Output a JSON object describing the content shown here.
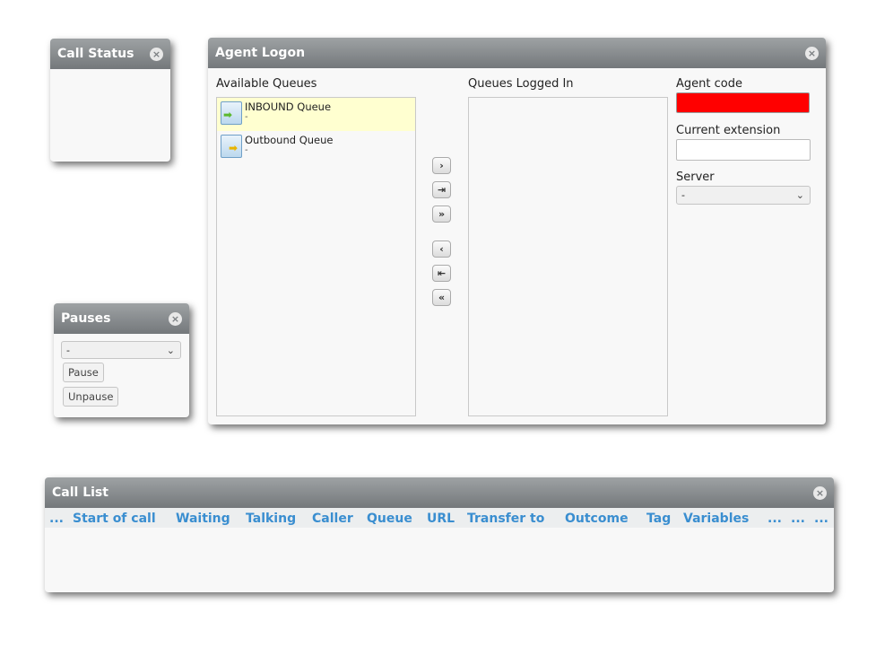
{
  "call_status": {
    "title": "Call Status"
  },
  "agent_logon": {
    "title": "Agent Logon",
    "available_label": "Available Queues",
    "logged_in_label": "Queues Logged In",
    "queues": [
      {
        "name": "INBOUND Queue",
        "sub": "-"
      },
      {
        "name": "Outbound Queue",
        "sub": "-"
      }
    ],
    "agent_code_label": "Agent code",
    "agent_code_value": "",
    "current_extension_label": "Current extension",
    "current_extension_value": "",
    "server_label": "Server",
    "server_value": "-",
    "move_buttons": [
      "›",
      "⇥",
      "»",
      "‹",
      "⇤",
      "«"
    ],
    "agent_code_color": "#ff0000"
  },
  "pauses": {
    "title": "Pauses",
    "select_value": "-",
    "pause_label": "Pause",
    "unpause_label": "Unpause"
  },
  "call_list": {
    "title": "Call List",
    "columns": [
      "...",
      "Start of call",
      "Waiting",
      "Talking",
      "Caller",
      "Queue",
      "URL",
      "Transfer to",
      "Outcome",
      "Tag",
      "Variables",
      "...",
      "...",
      "..."
    ]
  },
  "icons": {
    "close": "×",
    "chevron": "⌄"
  },
  "colors": {
    "header_accent": "#3a8ed0",
    "selected_row": "#ffffd0"
  }
}
